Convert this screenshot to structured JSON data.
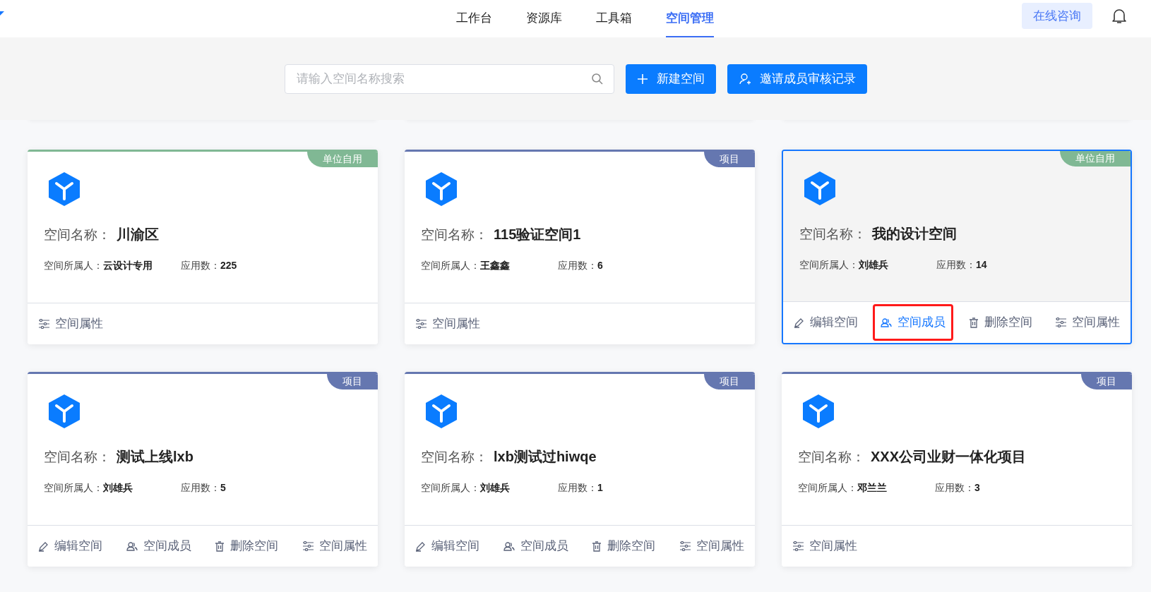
{
  "nav": {
    "tabs": [
      {
        "label": "工作台",
        "selected": false
      },
      {
        "label": "资源库",
        "selected": false
      },
      {
        "label": "工具箱",
        "selected": false
      },
      {
        "label": "空间管理",
        "selected": true
      }
    ],
    "consult_button": "在线咨询"
  },
  "toolbar": {
    "search": {
      "placeholder": "请输入空间名称搜索"
    },
    "buttons": [
      {
        "kind": "add",
        "label": "新建空间"
      },
      {
        "kind": "invite",
        "label": "邀请成员审核记录"
      }
    ]
  },
  "cards": [
    {
      "badge": "单位自用",
      "color": "#80b894",
      "name_label": "空间名称：",
      "name": "川渝区",
      "owner_label": "空间所属人：",
      "owner": "云设计专用",
      "apps_label": "应用数：",
      "apps": "225",
      "highlighted": false,
      "actions": [
        {
          "kind": "properties",
          "label": "空间属性",
          "selected": false
        }
      ]
    },
    {
      "badge": "项目",
      "color": "#6577b0",
      "name_label": "空间名称：",
      "name": "115验证空间1",
      "owner_label": "空间所属人：",
      "owner": "王鑫鑫",
      "apps_label": "应用数：",
      "apps": "6",
      "highlighted": false,
      "actions": [
        {
          "kind": "properties",
          "label": "空间属性",
          "selected": false
        }
      ]
    },
    {
      "badge": "单位自用",
      "color": "#80b894",
      "name_label": "空间名称：",
      "name": "我的设计空间",
      "owner_label": "空间所属人：",
      "owner": "刘雄兵",
      "apps_label": "应用数：",
      "apps": "14",
      "highlighted": true,
      "actions": [
        {
          "kind": "edit",
          "label": "编辑空间",
          "selected": false
        },
        {
          "kind": "members",
          "label": "空间成员",
          "selected": true
        },
        {
          "kind": "delete",
          "label": "删除空间",
          "selected": false
        },
        {
          "kind": "properties",
          "label": "空间属性",
          "selected": false
        }
      ]
    },
    {
      "badge": "项目",
      "color": "#6577b0",
      "name_label": "空间名称：",
      "name": "测试上线lxb",
      "owner_label": "空间所属人：",
      "owner": "刘雄兵",
      "apps_label": "应用数：",
      "apps": "5",
      "highlighted": false,
      "actions": [
        {
          "kind": "edit",
          "label": "编辑空间",
          "selected": false
        },
        {
          "kind": "members",
          "label": "空间成员",
          "selected": false
        },
        {
          "kind": "delete",
          "label": "删除空间",
          "selected": false
        },
        {
          "kind": "properties",
          "label": "空间属性",
          "selected": false
        }
      ]
    },
    {
      "badge": "项目",
      "color": "#6577b0",
      "name_label": "空间名称：",
      "name": "lxb测试过hiwqe",
      "owner_label": "空间所属人：",
      "owner": "刘雄兵",
      "apps_label": "应用数：",
      "apps": "1",
      "highlighted": false,
      "actions": [
        {
          "kind": "edit",
          "label": "编辑空间",
          "selected": false
        },
        {
          "kind": "members",
          "label": "空间成员",
          "selected": false
        },
        {
          "kind": "delete",
          "label": "删除空间",
          "selected": false
        },
        {
          "kind": "properties",
          "label": "空间属性",
          "selected": false
        }
      ]
    },
    {
      "badge": "项目",
      "color": "#6577b0",
      "name_label": "空间名称：",
      "name": "XXX公司业财一体化项目",
      "owner_label": "空间所属人：",
      "owner": "邓兰兰",
      "apps_label": "应用数：",
      "apps": "3",
      "highlighted": false,
      "actions": [
        {
          "kind": "properties",
          "label": "空间属性",
          "selected": false
        }
      ]
    }
  ]
}
